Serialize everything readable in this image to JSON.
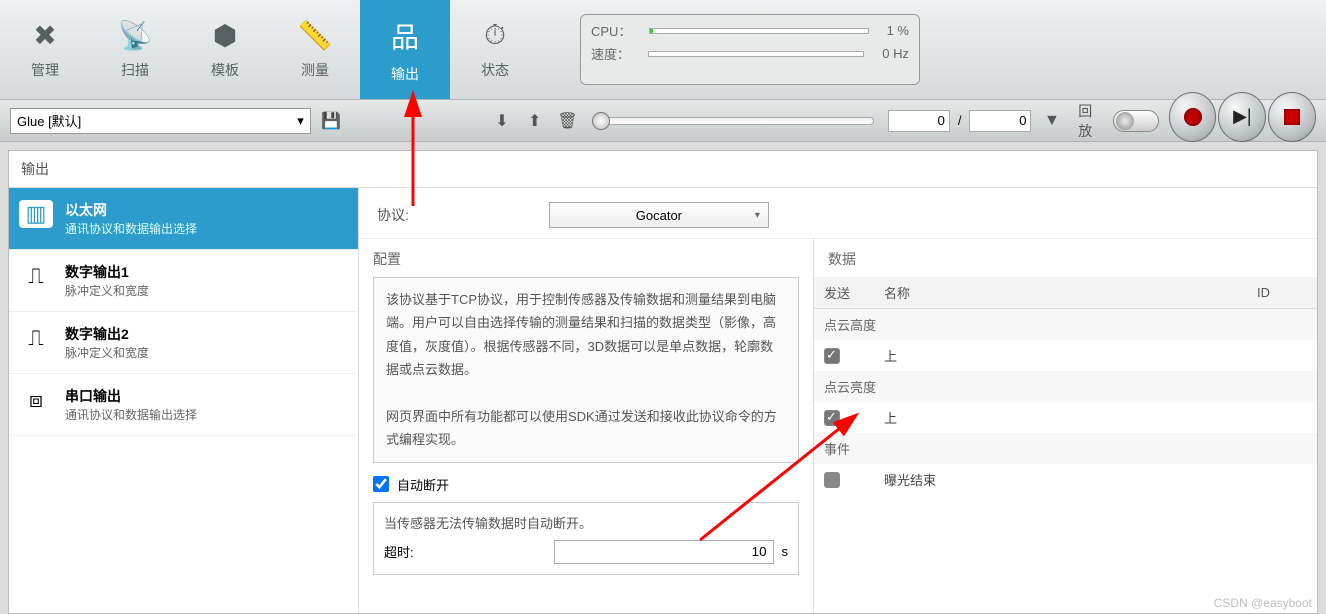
{
  "toolbar": {
    "manage": "管理",
    "scan": "扫描",
    "template": "模板",
    "measure": "测量",
    "output": "输出",
    "status": "状态"
  },
  "status_box": {
    "cpu_label": "CPU：",
    "cpu_value": "1 %",
    "speed_label": "速度：",
    "speed_value": "0 Hz"
  },
  "job_select": "Glue [默认]",
  "slider": {
    "pos": "0",
    "sep": "/",
    "total": "0"
  },
  "replay_label": "回放",
  "panel_title": "输出",
  "sidebar": {
    "items": [
      {
        "title": "以太网",
        "desc": "通讯协议和数据输出选择",
        "icon": "ethernet-icon"
      },
      {
        "title": "数字输出1",
        "desc": "脉冲定义和宽度",
        "icon": "pulse-icon"
      },
      {
        "title": "数字输出2",
        "desc": "脉冲定义和宽度",
        "icon": "pulse-icon"
      },
      {
        "title": "串口输出",
        "desc": "通讯协议和数据输出选择",
        "icon": "serial-icon"
      }
    ]
  },
  "protocol": {
    "label": "协议:",
    "value": "Gocator"
  },
  "config": {
    "header": "配置",
    "desc1": "该协议基于TCP协议，用于控制传感器及传输数据和测量结果到电脑端。用户可以自由选择传输的测量结果和扫描的数据类型（影像，高度值，灰度值）。根据传感器不同，3D数据可以是单点数据，轮廓数据或点云数据。",
    "desc2": "网页界面中所有功能都可以使用SDK通过发送和接收此协议命令的方式编程实现。",
    "auto_disconnect": "自动断开",
    "auto_disconnect_desc": "当传感器无法传输数据时自动断开。",
    "timeout_label": "超时:",
    "timeout_value": "10",
    "timeout_unit": "s"
  },
  "data": {
    "header": "数据",
    "col_send": "发送",
    "col_name": "名称",
    "col_id": "ID",
    "groups": [
      {
        "name": "点云高度",
        "rows": [
          {
            "checked": true,
            "name": "上"
          }
        ]
      },
      {
        "name": "点云亮度",
        "rows": [
          {
            "checked": true,
            "name": "上"
          }
        ]
      },
      {
        "name": "事件",
        "rows": [
          {
            "checked": false,
            "name": "曝光结束"
          }
        ]
      }
    ]
  },
  "watermark": "CSDN @easyboot"
}
